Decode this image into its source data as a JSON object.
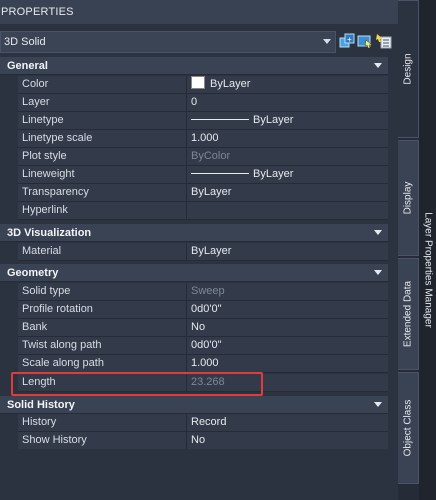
{
  "title": "PROPERTIES",
  "object_type": "3D Solid",
  "sections": {
    "general": {
      "label": "General",
      "rows": [
        {
          "name": "Color",
          "value": "ByLayer"
        },
        {
          "name": "Layer",
          "value": "0"
        },
        {
          "name": "Linetype",
          "value": "ByLayer"
        },
        {
          "name": "Linetype scale",
          "value": "1.000"
        },
        {
          "name": "Plot style",
          "value": "ByColor"
        },
        {
          "name": "Lineweight",
          "value": "ByLayer"
        },
        {
          "name": "Transparency",
          "value": "ByLayer"
        },
        {
          "name": "Hyperlink",
          "value": ""
        }
      ]
    },
    "viz": {
      "label": "3D Visualization",
      "rows": [
        {
          "name": "Material",
          "value": "ByLayer"
        }
      ]
    },
    "geometry": {
      "label": "Geometry",
      "rows": [
        {
          "name": "Solid type",
          "value": "Sweep"
        },
        {
          "name": "Profile rotation",
          "value": "0d0'0\""
        },
        {
          "name": "Bank",
          "value": "No"
        },
        {
          "name": "Twist along path",
          "value": "0d0'0\""
        },
        {
          "name": "Scale along path",
          "value": "1.000"
        },
        {
          "name": "Length",
          "value": "23.268"
        }
      ]
    },
    "history": {
      "label": "Solid History",
      "rows": [
        {
          "name": "History",
          "value": "Record"
        },
        {
          "name": "Show History",
          "value": "No"
        }
      ]
    }
  },
  "side_tabs": {
    "design": "Design",
    "display": "Display",
    "extended": "Extended Data",
    "object_class": "Object Class",
    "layer_manager": "Layer Properties Manager"
  },
  "colors": {
    "highlight": "#e23b3b",
    "color_swatch": "#ffffff"
  },
  "icons": [
    "quick-select-icon",
    "select-objects-icon",
    "toggle-pickadd-icon"
  ]
}
